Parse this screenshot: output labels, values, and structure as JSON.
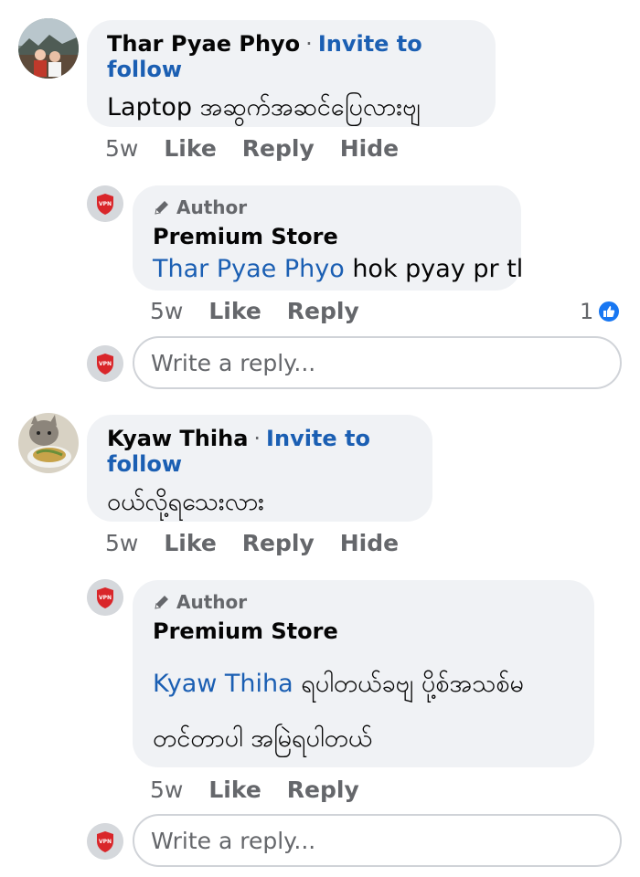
{
  "comments": [
    {
      "author": "Thar Pyae Phyo",
      "separator": "·",
      "follow_label": "Invite to follow",
      "text": "Laptop အဆွက်အဆင်ပြေလားဗျ",
      "time": "5w",
      "actions": [
        "Like",
        "Reply",
        "Hide"
      ],
      "reply": {
        "badge": "Author",
        "author": "Premium Store",
        "mention": "Thar Pyae Phyo",
        "text": " hok pyay pr tl",
        "time": "5w",
        "actions": [
          "Like",
          "Reply"
        ],
        "reaction_count": "1"
      },
      "reply_placeholder": "Write a reply..."
    },
    {
      "author": "Kyaw Thiha",
      "separator": "·",
      "follow_label": "Invite to follow",
      "text": "ဝယ်လို့ရသေးလား",
      "time": "5w",
      "actions": [
        "Like",
        "Reply",
        "Hide"
      ],
      "reply": {
        "badge": "Author",
        "author": "Premium Store",
        "mention": "Kyaw Thiha",
        "text_line1": " ရပါတယ်ခဗျ ပို့စ်အသစ်မ",
        "text_line2": "တင်တာပါ အမြဲရပါတယ်",
        "time": "5w",
        "actions": [
          "Like",
          "Reply"
        ]
      },
      "reply_placeholder": "Write a reply..."
    }
  ],
  "colors": {
    "bubble": "#f0f2f5",
    "link": "#1b5fb3",
    "muted": "#65676b",
    "like_blue": "#1877f2"
  }
}
